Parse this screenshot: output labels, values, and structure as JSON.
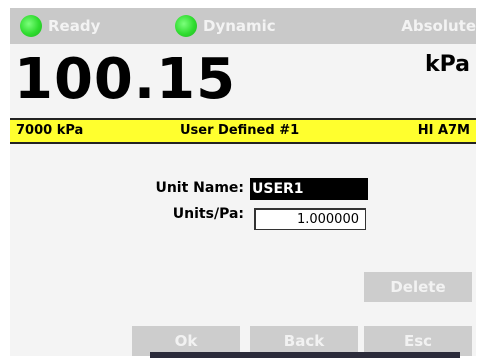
{
  "status": {
    "ready": "Ready",
    "dynamic": "Dynamic",
    "absolute": "Absolute",
    "led_color": "#2fdc2f"
  },
  "reading": {
    "value": "100.15",
    "unit": "kPa"
  },
  "infobar": {
    "range": "7000 kPa",
    "title": "User Defined #1",
    "model": "HI A7M"
  },
  "form": {
    "unit_name_label": "Unit Name:",
    "unit_name_value": "USER1",
    "units_per_pa_label": "Units/Pa:",
    "units_per_pa_value": "1.000000"
  },
  "buttons": {
    "delete": "Delete",
    "ok": "Ok",
    "back": "Back",
    "esc": "Esc"
  }
}
